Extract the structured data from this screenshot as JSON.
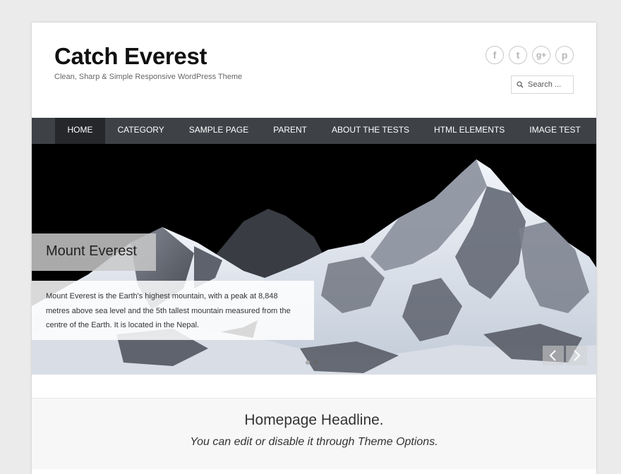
{
  "site": {
    "title": "Catch Everest",
    "description": "Clean, Sharp & Simple Responsive WordPress Theme"
  },
  "social": [
    {
      "name": "facebook-icon",
      "glyph": "f"
    },
    {
      "name": "twitter-icon",
      "glyph": "t"
    },
    {
      "name": "google-plus-icon",
      "glyph": "g+"
    },
    {
      "name": "pinterest-icon",
      "glyph": "p"
    }
  ],
  "search": {
    "placeholder": "Search ..."
  },
  "nav": {
    "items": [
      "HOME",
      "CATEGORY",
      "SAMPLE PAGE",
      "PARENT",
      "ABOUT THE TESTS",
      "HTML ELEMENTS",
      "IMAGE TEST"
    ],
    "active": "HOME"
  },
  "slider": {
    "title": "Mount Everest",
    "text": "Mount Everest is the Earth's highest mountain, with a peak at 8,848 metres above sea level and the 5th tallest mountain measured from the centre of the Earth. It is located in the Nepal.",
    "prev_icon": "chevron-left-icon",
    "next_icon": "chevron-right-icon"
  },
  "headline": {
    "title": "Homepage Headline.",
    "subtitle": "You can edit or disable it through Theme Options."
  },
  "colors": {
    "nav_bg": "#3e4146",
    "nav_active": "#25272b",
    "page_bg": "#ebebeb"
  }
}
